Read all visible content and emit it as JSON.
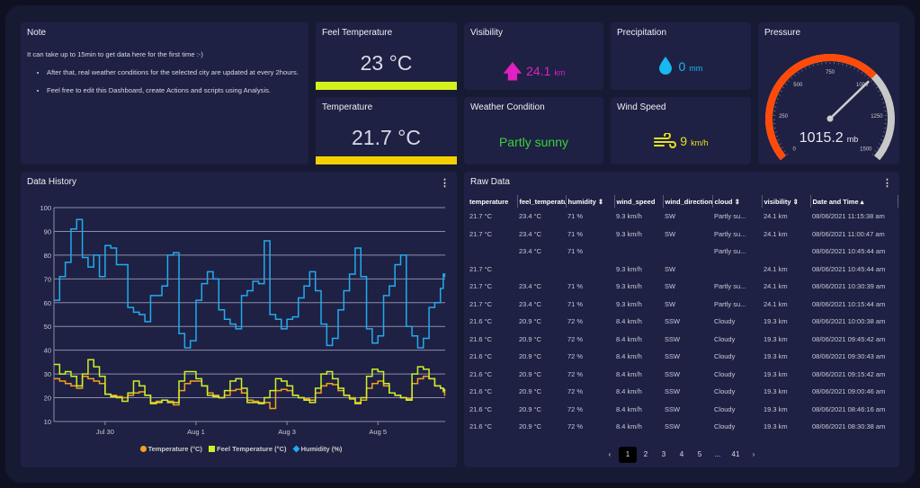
{
  "note": {
    "title": "Note",
    "intro": "It can take up to 15min to get data here for the first time :-)",
    "bullets": [
      "After that, real weather conditions for the selected city are updated at every 2hours.",
      "Feel free to edit this Dashboard, create Actions and scripts using Analysis."
    ]
  },
  "feel_temperature": {
    "title": "Feel Temperature",
    "value": "23 °C",
    "bar_color": "#d4f01e"
  },
  "temperature": {
    "title": "Temperature",
    "value": "21.7 °C",
    "bar_color": "#f5d000"
  },
  "visibility": {
    "title": "Visibility",
    "value": "24.1",
    "unit": "km",
    "icon": "arrow-up-icon",
    "color": "#e020c0"
  },
  "precipitation": {
    "title": "Precipitation",
    "value": "0",
    "unit": "mm",
    "icon": "water-drop-icon",
    "color": "#18b8f0"
  },
  "weather_condition": {
    "title": "Weather Condition",
    "value": "Partly sunny",
    "color": "#3ad13a"
  },
  "wind_speed": {
    "title": "Wind Speed",
    "value": "9",
    "unit": "km/h",
    "icon": "wind-icon",
    "color": "#e8e020"
  },
  "pressure": {
    "title": "Pressure",
    "value": "1015.2",
    "unit": "mb",
    "min": 0,
    "max": 1500,
    "reading": 1015.2,
    "ticks": [
      "0",
      "250",
      "500",
      "750",
      "1000",
      "1250",
      "1500"
    ],
    "fill_color": "#ff4a0a",
    "track_color": "#c8c8c8"
  },
  "history": {
    "title": "Data History"
  },
  "chart_data": {
    "type": "line",
    "title": "",
    "xlabel": "",
    "ylabel": "",
    "ylim": [
      10,
      100
    ],
    "grid": true,
    "legend": "bottom",
    "yticks": [
      "10",
      "20",
      "30",
      "40",
      "50",
      "60",
      "70",
      "80",
      "90",
      "100"
    ],
    "xticks": [
      {
        "label": "Jul 30",
        "x": "2021-07-30T00:00"
      },
      {
        "label": "Aug 1",
        "x": "2021-08-01T00:00"
      },
      {
        "label": "Aug 3",
        "x": "2021-08-03T00:00"
      },
      {
        "label": "Aug 5",
        "x": "2021-08-05T00:00"
      }
    ],
    "xlim": [
      "2021-07-28T21:00",
      "2021-08-06T11:30"
    ],
    "x": [
      "2021-07-28T21:00",
      "2021-07-29T00:00",
      "2021-07-29T03:00",
      "2021-07-29T06:00",
      "2021-07-29T09:00",
      "2021-07-29T12:00",
      "2021-07-29T15:00",
      "2021-07-29T18:00",
      "2021-07-29T21:00",
      "2021-07-30T00:00",
      "2021-07-30T03:00",
      "2021-07-30T06:00",
      "2021-07-30T09:00",
      "2021-07-30T12:00",
      "2021-07-30T15:00",
      "2021-07-30T18:00",
      "2021-07-30T21:00",
      "2021-07-31T00:00",
      "2021-07-31T03:00",
      "2021-07-31T06:00",
      "2021-07-31T09:00",
      "2021-07-31T12:00",
      "2021-07-31T15:00",
      "2021-07-31T18:00",
      "2021-07-31T21:00",
      "2021-08-01T00:00",
      "2021-08-01T03:00",
      "2021-08-01T06:00",
      "2021-08-01T09:00",
      "2021-08-01T12:00",
      "2021-08-01T15:00",
      "2021-08-01T18:00",
      "2021-08-01T21:00",
      "2021-08-02T00:00",
      "2021-08-02T03:00",
      "2021-08-02T06:00",
      "2021-08-02T09:00",
      "2021-08-02T12:00",
      "2021-08-02T15:00",
      "2021-08-02T18:00",
      "2021-08-02T21:00",
      "2021-08-03T00:00",
      "2021-08-03T03:00",
      "2021-08-03T06:00",
      "2021-08-03T09:00",
      "2021-08-03T12:00",
      "2021-08-03T15:00",
      "2021-08-03T18:00",
      "2021-08-03T21:00",
      "2021-08-04T00:00",
      "2021-08-04T03:00",
      "2021-08-04T06:00",
      "2021-08-04T09:00",
      "2021-08-04T12:00",
      "2021-08-04T15:00",
      "2021-08-04T18:00",
      "2021-08-04T21:00",
      "2021-08-05T00:00",
      "2021-08-05T03:00",
      "2021-08-05T06:00",
      "2021-08-05T09:00",
      "2021-08-05T12:00",
      "2021-08-05T15:00",
      "2021-08-05T18:00",
      "2021-08-05T21:00",
      "2021-08-06T00:00",
      "2021-08-06T03:00",
      "2021-08-06T06:00",
      "2021-08-06T09:00",
      "2021-08-06T10:30",
      "2021-08-06T11:15"
    ],
    "series": [
      {
        "name": "Temperature (°C)",
        "color": "#f5a020",
        "marker": "circle",
        "values": [
          28,
          27,
          26,
          25,
          24,
          29,
          28,
          27,
          26,
          21.5,
          21,
          20.5,
          20,
          21,
          22,
          22.5,
          21,
          18,
          18.5,
          19,
          18.5,
          17,
          23,
          26,
          27,
          27,
          25,
          22,
          21,
          20,
          21,
          23,
          23.5,
          22,
          19,
          18.5,
          18,
          18,
          15.5,
          23,
          23.5,
          23,
          21,
          20,
          19.5,
          19,
          22,
          25,
          26,
          25.5,
          23,
          21,
          20,
          18,
          19,
          24,
          26,
          27,
          25,
          22,
          21,
          20,
          19.5,
          26,
          28,
          29,
          28,
          25,
          24,
          22.5,
          21
        ]
      },
      {
        "name": "Feel Temperature (°C)",
        "color": "#cdf02a",
        "marker": "square",
        "values": [
          34,
          30,
          31,
          29,
          25,
          30,
          36,
          33,
          29,
          21.5,
          20.5,
          20,
          18.5,
          22,
          27,
          25,
          21,
          17.5,
          18,
          19,
          18,
          18,
          27,
          31,
          31,
          28,
          25,
          21,
          20.5,
          20,
          23,
          27,
          28,
          24,
          18,
          18,
          17.5,
          20,
          23,
          28,
          27,
          25,
          21,
          20,
          19,
          18,
          24,
          30,
          31,
          28,
          24,
          21,
          19.5,
          17.5,
          20,
          29,
          32,
          31,
          26,
          22,
          21,
          20,
          19,
          30,
          33,
          32,
          28,
          25,
          24,
          23,
          23.5
        ]
      },
      {
        "name": "Humidity (%)",
        "color": "#22aaf0",
        "marker": "diamond",
        "values": [
          61,
          71,
          77,
          91,
          95,
          79,
          75,
          80,
          71,
          84,
          83,
          76,
          76,
          58,
          56,
          55,
          52,
          63,
          63,
          67,
          80,
          81,
          47,
          41,
          44,
          61,
          68,
          73,
          70,
          57,
          53,
          51,
          49,
          63,
          65,
          69,
          68,
          86,
          55,
          53,
          49,
          53,
          54,
          62,
          67,
          73,
          65,
          51,
          42,
          45,
          57,
          65,
          72,
          83,
          71,
          49,
          43,
          46,
          63,
          67,
          76,
          80,
          50,
          46,
          41,
          45,
          58,
          60,
          66,
          72,
          71
        ]
      }
    ]
  },
  "raw": {
    "title": "Raw Data",
    "columns": [
      "temperature",
      "feel_temperature",
      "humidity ⇕",
      "wind_speed",
      "wind_direction",
      "cloud ⇕",
      "visibility ⇕",
      "Date and Time ▴"
    ],
    "rows": [
      [
        "21.7 °C",
        "23.4 °C",
        "71 %",
        "9.3 km/h",
        "SW",
        "Partly su...",
        "24.1 km",
        "08/06/2021 11:15:38 am"
      ],
      [
        "21.7 °C",
        "23.4 °C",
        "71 %",
        "9.3 km/h",
        "SW",
        "Partly su...",
        "24.1 km",
        "08/06/2021 11:00:47 am"
      ],
      [
        "",
        "23.4 °C",
        "71 %",
        "",
        "",
        "Partly su...",
        "",
        "08/06/2021 10:45:44 am"
      ],
      [
        "21.7 °C",
        "",
        "",
        "9.3 km/h",
        "SW",
        "",
        "24.1 km",
        "08/06/2021 10:45:44 am"
      ],
      [
        "21.7 °C",
        "23.4 °C",
        "71 %",
        "9.3 km/h",
        "SW",
        "Partly su...",
        "24.1 km",
        "08/06/2021 10:30:39 am"
      ],
      [
        "21.7 °C",
        "23.4 °C",
        "71 %",
        "9.3 km/h",
        "SW",
        "Partly su...",
        "24.1 km",
        "08/06/2021 10:15:44 am"
      ],
      [
        "21.6 °C",
        "20.9 °C",
        "72 %",
        "8.4 km/h",
        "SSW",
        "Cloudy",
        "19.3 km",
        "08/06/2021 10:00:38 am"
      ],
      [
        "21.6 °C",
        "20.9 °C",
        "72 %",
        "8.4 km/h",
        "SSW",
        "Cloudy",
        "19.3 km",
        "08/06/2021 09:45:42 am"
      ],
      [
        "21.6 °C",
        "20.9 °C",
        "72 %",
        "8.4 km/h",
        "SSW",
        "Cloudy",
        "19.3 km",
        "08/06/2021 09:30:43 am"
      ],
      [
        "21.6 °C",
        "20.9 °C",
        "72 %",
        "8.4 km/h",
        "SSW",
        "Cloudy",
        "19.3 km",
        "08/06/2021 09:15:42 am"
      ],
      [
        "21.6 °C",
        "20.9 °C",
        "72 %",
        "8.4 km/h",
        "SSW",
        "Cloudy",
        "19.3 km",
        "08/06/2021 09:00:46 am"
      ],
      [
        "21.6 °C",
        "20.9 °C",
        "72 %",
        "8.4 km/h",
        "SSW",
        "Cloudy",
        "19.3 km",
        "08/06/2021 08:46:16 am"
      ],
      [
        "21.6 °C",
        "20.9 °C",
        "72 %",
        "8.4 km/h",
        "SSW",
        "Cloudy",
        "19.3 km",
        "08/06/2021 08:30:38 am"
      ]
    ],
    "pagination": {
      "prev": "‹",
      "pages": [
        "1",
        "2",
        "3",
        "4",
        "5",
        "...",
        "41"
      ],
      "current": "1",
      "next": "›"
    }
  },
  "menu_icon": "⋮"
}
